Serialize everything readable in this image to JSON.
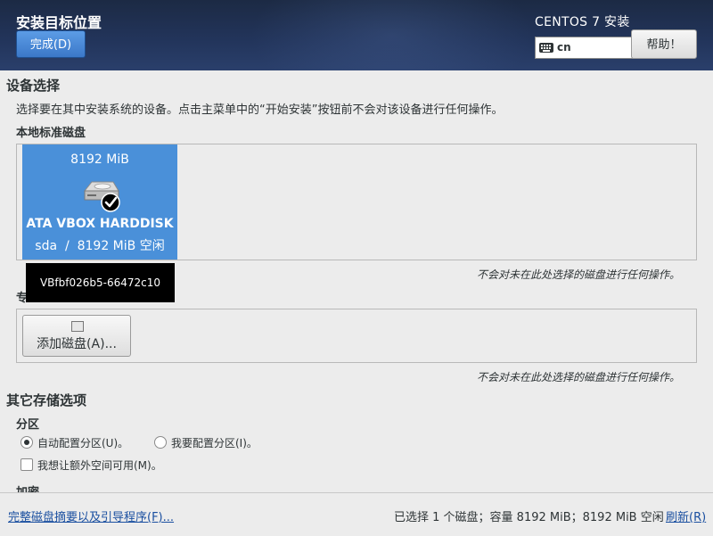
{
  "header": {
    "title": "安装目标位置",
    "done_button": "完成(D)",
    "product": "CENTOS 7 安装",
    "keyboard_layout": "cn",
    "help_button": "帮助！"
  },
  "device_selection": {
    "title": "设备选择",
    "description": "选择要在其中安装系统的设备。点击主菜单中的“开始安装”按钮前不会对该设备进行任何操作。",
    "local_disks_label": "本地标准磁盘",
    "disks": [
      {
        "size": "8192 MiB",
        "name": "ATA VBOX HARDDISK",
        "device": "sda",
        "separator": "/",
        "free": "8192 MiB 空闲",
        "selected": true,
        "tooltip": "VBfbf026b5-66472c10"
      }
    ],
    "local_note": "不会对未在此处选择的磁盘进行任何操作。",
    "specialized_label_partial": "专",
    "add_disk_button": "添加磁盘(A)...",
    "specialized_note": "不会对未在此处选择的磁盘进行任何操作。"
  },
  "other_storage": {
    "title": "其它存储选项",
    "partitioning_label": "分区",
    "auto_partition": "自动配置分区(U)。",
    "manual_partition": "我要配置分区(I)。",
    "auto_selected": true,
    "extra_space": "我想让额外空间可用(M)。",
    "extra_space_checked": false,
    "encryption_label": "加密"
  },
  "footer": {
    "summary_link": "完整磁盘摘要以及引导程序(F)...",
    "status": "已选择 1 个磁盘；容量 8192 MiB；8192 MiB 空闲",
    "refresh_link": "刷新(R)"
  },
  "colors": {
    "header_bg": "#22345a",
    "selected_disk": "#4a90d9",
    "primary_button": "#3b78c8",
    "link": "#1a4fa0"
  }
}
